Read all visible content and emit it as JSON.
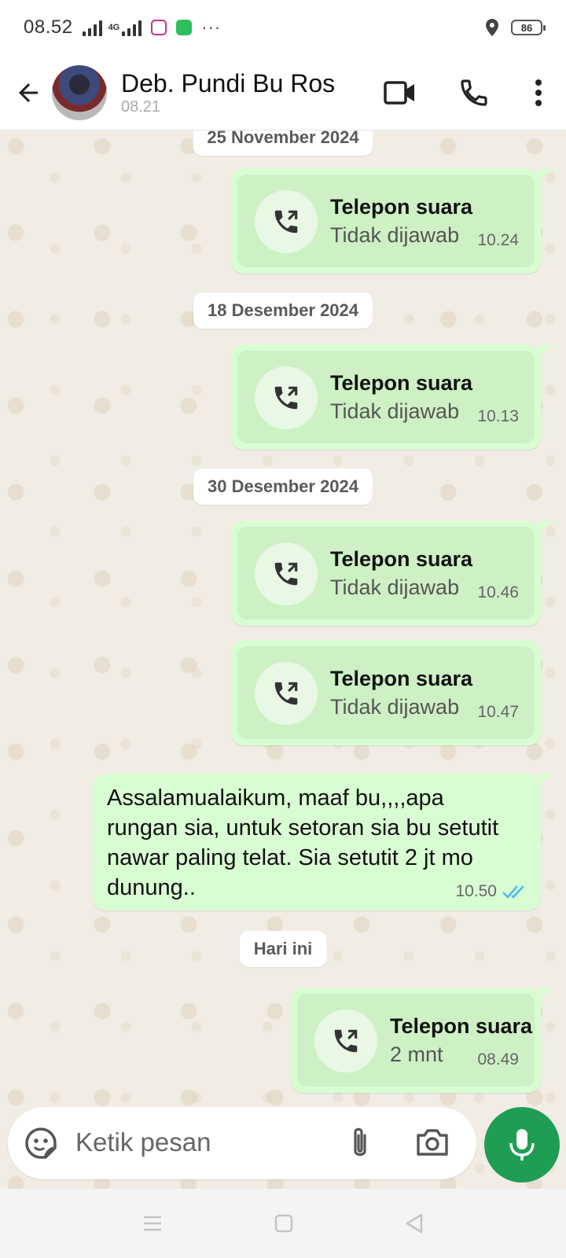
{
  "status": {
    "time": "08.52",
    "network": "4G",
    "battery": "86"
  },
  "header": {
    "name": "Deb. Pundi Bu Ros",
    "last_seen": "08.21"
  },
  "messages": [
    {
      "date": "25 November 2024"
    },
    {
      "title": "Telepon suara",
      "sub": "Tidak dijawab",
      "time": "10.24"
    },
    {
      "date": "18 Desember 2024"
    },
    {
      "title": "Telepon suara",
      "sub": "Tidak dijawab",
      "time": "10.13"
    },
    {
      "date": "30 Desember 2024"
    },
    {
      "title": "Telepon suara",
      "sub": "Tidak dijawab",
      "time": "10.46"
    },
    {
      "title": "Telepon suara",
      "sub": "Tidak dijawab",
      "time": "10.47"
    },
    {
      "text": "Assalamualaikum, maaf bu,,,,apa rungan sia, untuk setoran sia bu setutit nawar paling telat. Sia setutit 2 jt mo dunung..",
      "time": "10.50",
      "status": "read"
    },
    {
      "date": "Hari ini"
    },
    {
      "title": "Telepon suara",
      "sub": "2 mnt",
      "time": "08.49"
    }
  ],
  "composer": {
    "placeholder": "Ketik pesan"
  },
  "colors": {
    "bubble": "#d9fdd3",
    "card": "#cdf1c5",
    "accent": "#1f9d55",
    "read_ticks": "#53bdeb"
  },
  "icons": [
    "back-arrow-icon",
    "video-call-icon",
    "voice-call-icon",
    "more-options-icon",
    "outgoing-call-icon",
    "double-check-icon",
    "sticker-icon",
    "attach-icon",
    "camera-icon",
    "mic-icon"
  ]
}
